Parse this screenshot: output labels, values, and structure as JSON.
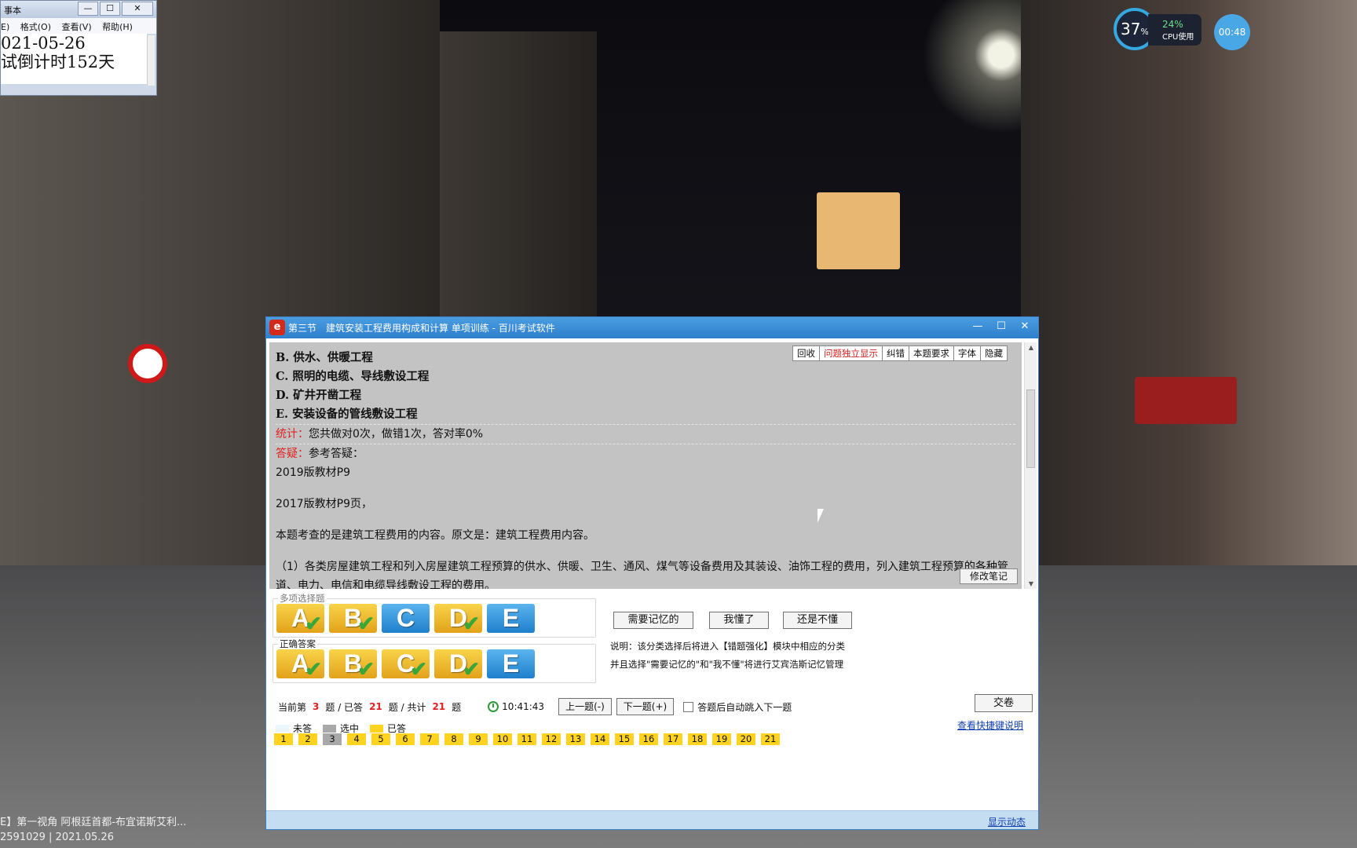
{
  "notepad": {
    "title": "事本",
    "menu": [
      "E)",
      "格式(O)",
      "查看(V)",
      "帮助(H)"
    ],
    "lines": [
      "021-05-26",
      "试倒计时152天"
    ]
  },
  "overlay": {
    "gauge": "37",
    "gauge_unit": "%",
    "cpu_pct": "24%",
    "cpu_label": "CPU使用",
    "timer": "00:48"
  },
  "caption": {
    "line1": "E】第一视角 阿根廷首都-布宜诺斯艾利...",
    "line2": "2591029 | 2021.05.26"
  },
  "window": {
    "logo": "e",
    "title": "第三节　建筑安装工程费用构成和计算 单项训练 - 百川考试软件",
    "controls": [
      "—",
      "☐",
      "✕"
    ]
  },
  "toolbar": [
    "回收",
    "问题独立显示",
    "纠错",
    "本题要求",
    "字体",
    "隐藏"
  ],
  "content": {
    "options": [
      "B. 供水、供暖工程",
      "C. 照明的电缆、导线敷设工程",
      "D. 矿井开凿工程",
      "E. 安装设备的管线敷设工程"
    ],
    "stats_label": "统计：",
    "stats_text": "您共做对0次，做错1次，答对率0%",
    "qa_label": "答疑：",
    "qa_text": "参考答疑：",
    "ref1": "2019版教材P9",
    "ref2": "2017版教材P9页，",
    "para1": "本题考查的是建筑工程费用的内容。原文是：建筑工程费用内容。",
    "para2": "（1）各类房屋建筑工程和列入房屋建筑工程预算的供水、供暖、卫生、通风、煤气等设备费用及其装设、油饰工程的费用，列入建筑工程预算的各种管道、电力、电信和电缆导线敷设工程的费用。",
    "edit_note": "修改笔记"
  },
  "answers": {
    "my_label": "多项选择题",
    "correct_label": "正确答案",
    "letters": [
      "A",
      "B",
      "C",
      "D",
      "E"
    ],
    "my_selected": [
      true,
      true,
      false,
      true,
      false
    ],
    "correct_selected": [
      true,
      true,
      true,
      true,
      false
    ],
    "check": "✔"
  },
  "memory": {
    "btn_remember": "需要记忆的",
    "btn_understood": "我懂了",
    "btn_not_understood": "还是不懂",
    "note1": "说明：该分类选择后将进入【错题强化】模块中相应的分类",
    "note2": "并且选择\"需要记忆的\"和\"我不懂\"将进行艾宾浩斯记忆管理"
  },
  "nav": {
    "current_prefix": "当前第",
    "current": "3",
    "answered_prefix": "题 / 已答",
    "answered": "21",
    "total_prefix": "题 / 共计",
    "total": "21",
    "total_suffix": "题",
    "time": "10:41:43",
    "prev": "上一题(-)",
    "next": "下一题(+)",
    "auto_next": "答题后自动跳入下一题",
    "submit": "交卷"
  },
  "legend": {
    "unanswered": "未答",
    "selected": "选中",
    "answered": "已答",
    "shortcut": "查看快捷键说明"
  },
  "questions": [
    "1",
    "2",
    "3",
    "4",
    "5",
    "6",
    "7",
    "8",
    "9",
    "10",
    "11",
    "12",
    "13",
    "14",
    "15",
    "16",
    "17",
    "18",
    "19",
    "20",
    "21"
  ],
  "current_question": "3",
  "status_link": "显示动态"
}
